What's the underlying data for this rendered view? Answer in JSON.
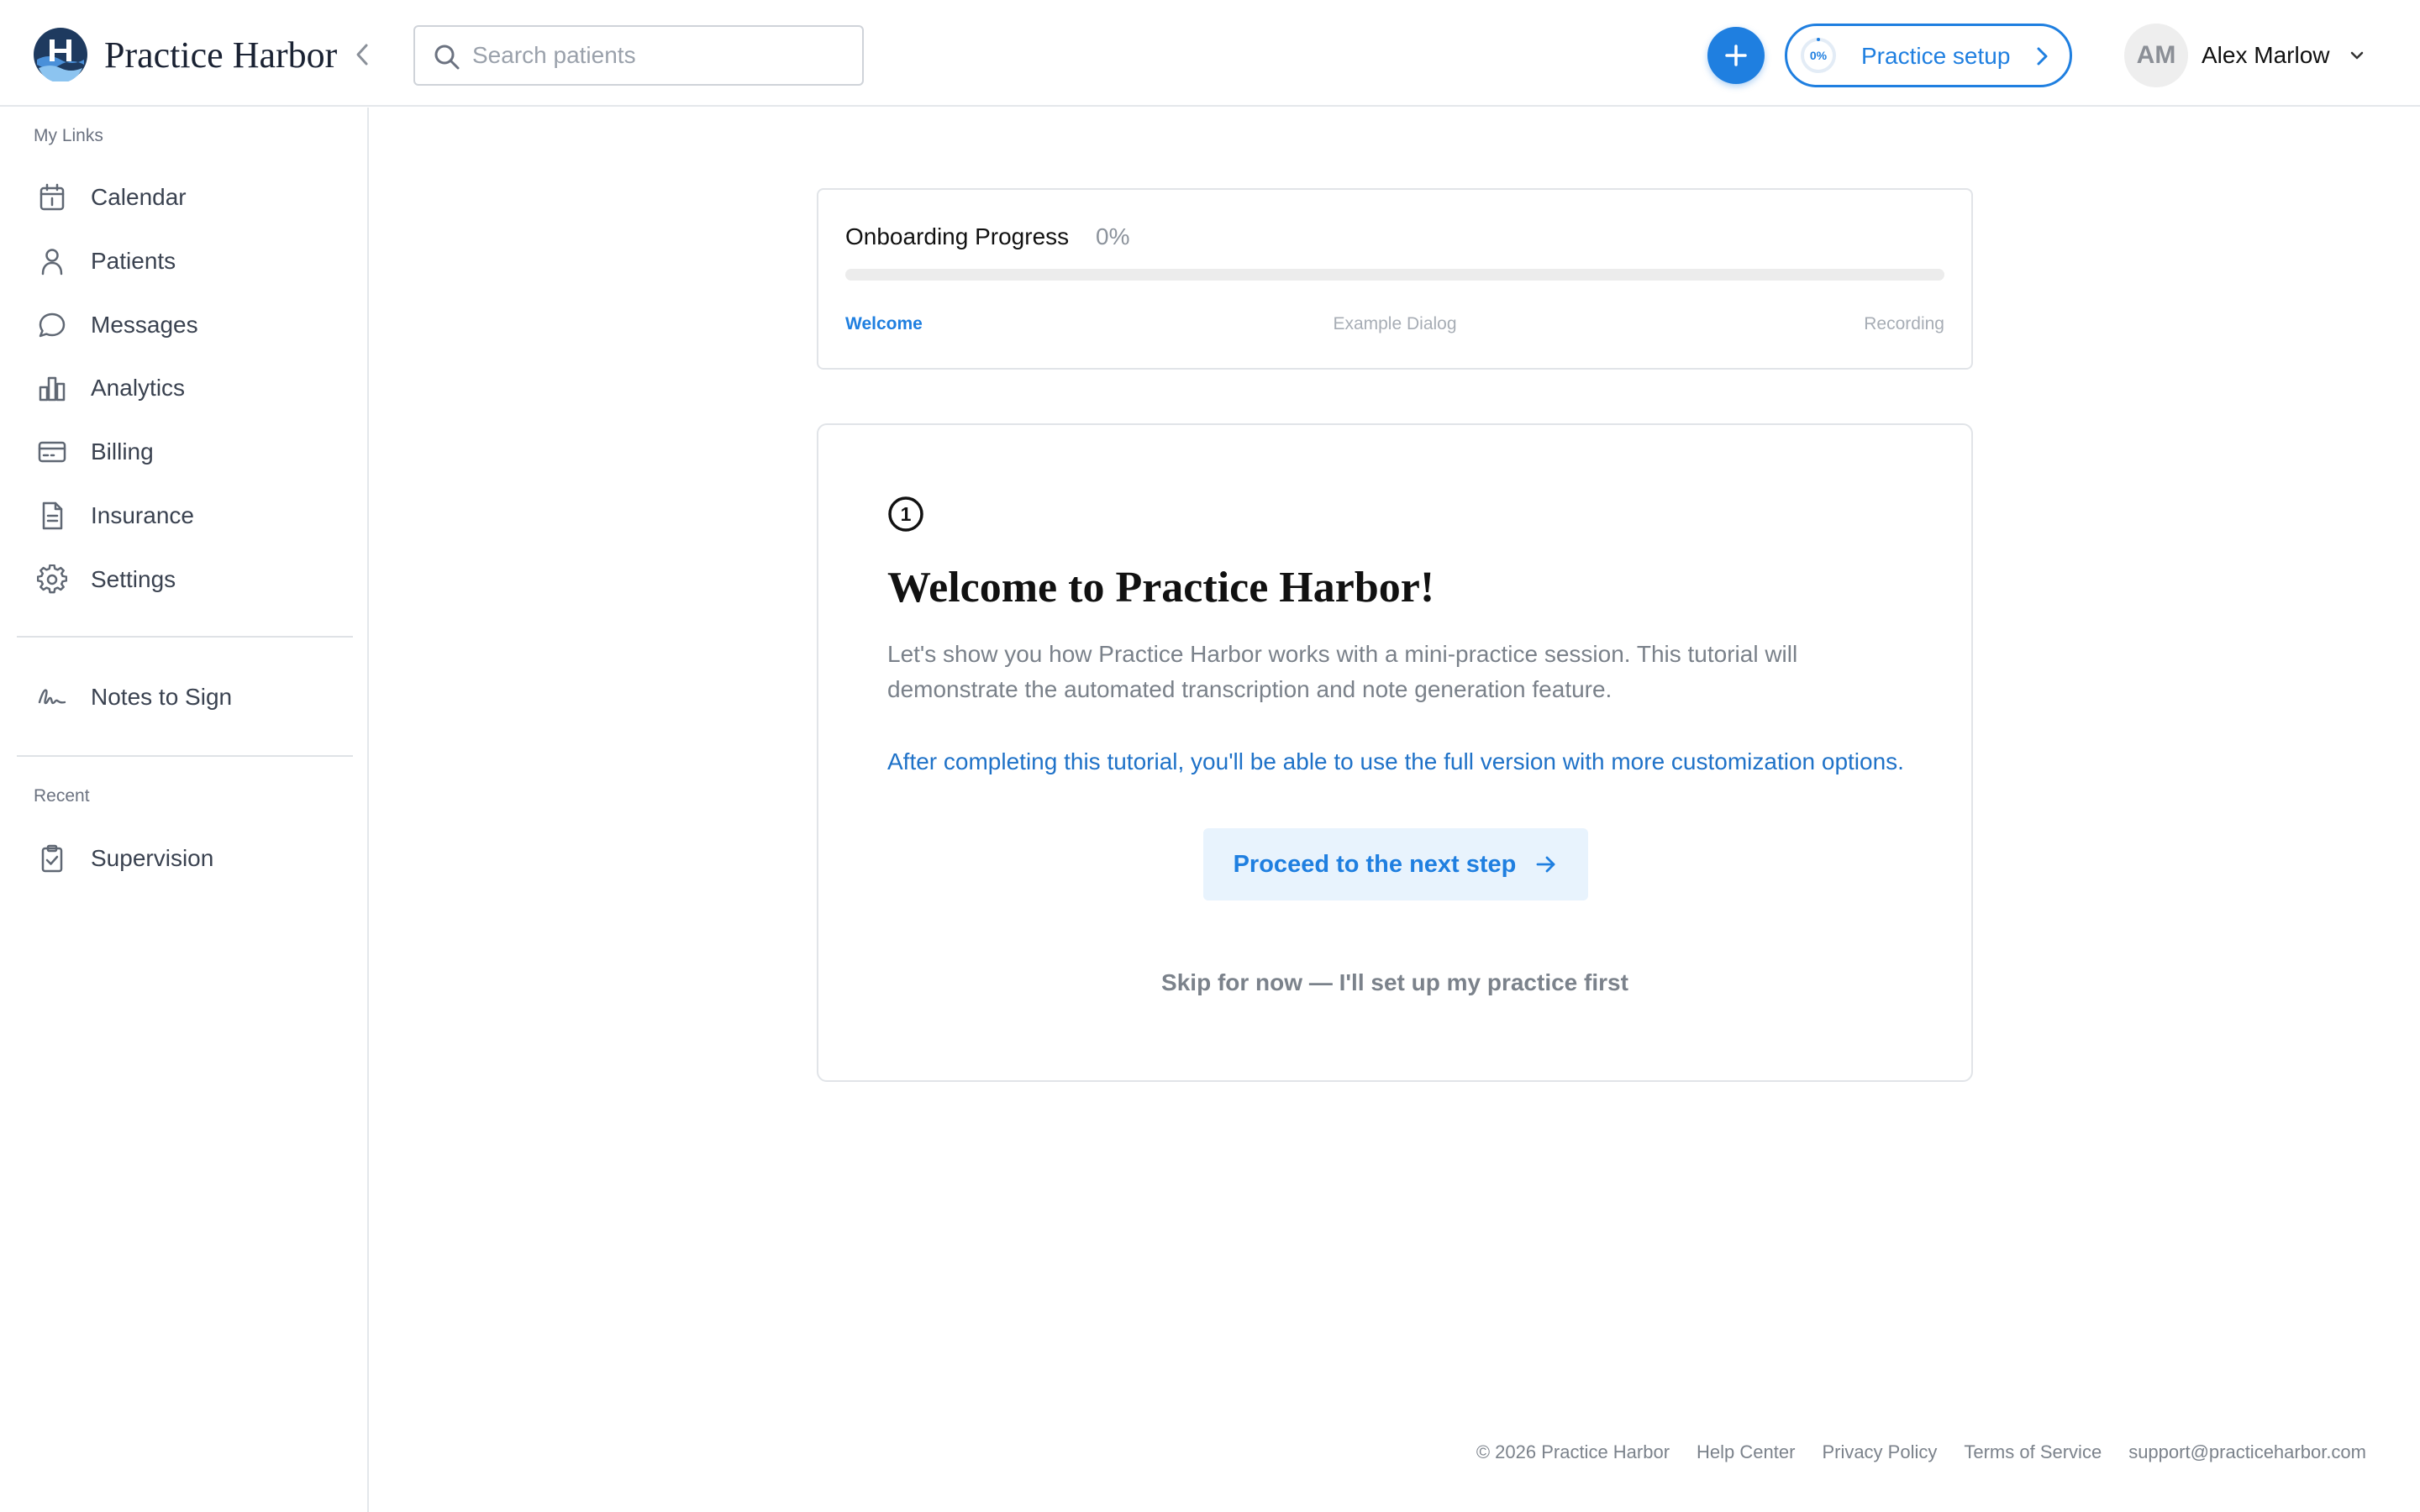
{
  "app": {
    "title": "Practice Harbor"
  },
  "search": {
    "placeholder": "Search patients"
  },
  "setup": {
    "label": "Practice setup",
    "ring_label": "0%",
    "progress": 0
  },
  "user": {
    "initials": "AM",
    "name": "Alex Marlow"
  },
  "sidebar": {
    "my_links_label": "My Links",
    "items": [
      {
        "label": "Calendar",
        "icon": "calendar-icon"
      },
      {
        "label": "Patients",
        "icon": "user-icon"
      },
      {
        "label": "Messages",
        "icon": "chat-bubble-icon"
      },
      {
        "label": "Analytics",
        "icon": "bar-chart-icon"
      },
      {
        "label": "Billing",
        "icon": "credit-card-icon"
      },
      {
        "label": "Insurance",
        "icon": "document-icon"
      },
      {
        "label": "Settings",
        "icon": "gear-icon"
      }
    ],
    "notes_to_sign": {
      "label": "Notes to Sign",
      "icon": "signature-icon"
    },
    "recent_label": "Recent",
    "recent_items": [
      {
        "label": "Supervision",
        "icon": "clipboard-check-icon"
      }
    ]
  },
  "onboarding": {
    "title": "Onboarding Progress",
    "percent_label": "0%",
    "progress": 0,
    "steps": [
      "Welcome",
      "Example Dialog",
      "Recording"
    ],
    "active_step": 0
  },
  "welcome": {
    "step_number": "1",
    "title": "Welcome to Practice Harbor!",
    "description": "Let's show you how Practice Harbor works with a mini-practice session. This tutorial will demonstrate the automated transcription and note generation feature.",
    "note": "After completing this tutorial, you'll be able to use the full version with more customization options.",
    "next_button": "Proceed to the next step",
    "skip_link": "Skip for now — I'll set up my practice first"
  },
  "footer": {
    "copyright": "© 2026 Practice Harbor",
    "links": [
      "Help Center",
      "Privacy Policy",
      "Terms of Service",
      "support@practiceharbor.com"
    ]
  },
  "colors": {
    "accent": "#1f7fe0",
    "accent_light": "#e8f3fd",
    "brand_dark": "#1e3a5f",
    "muted_text": "#7a818a",
    "border": "#e1e4e8"
  }
}
